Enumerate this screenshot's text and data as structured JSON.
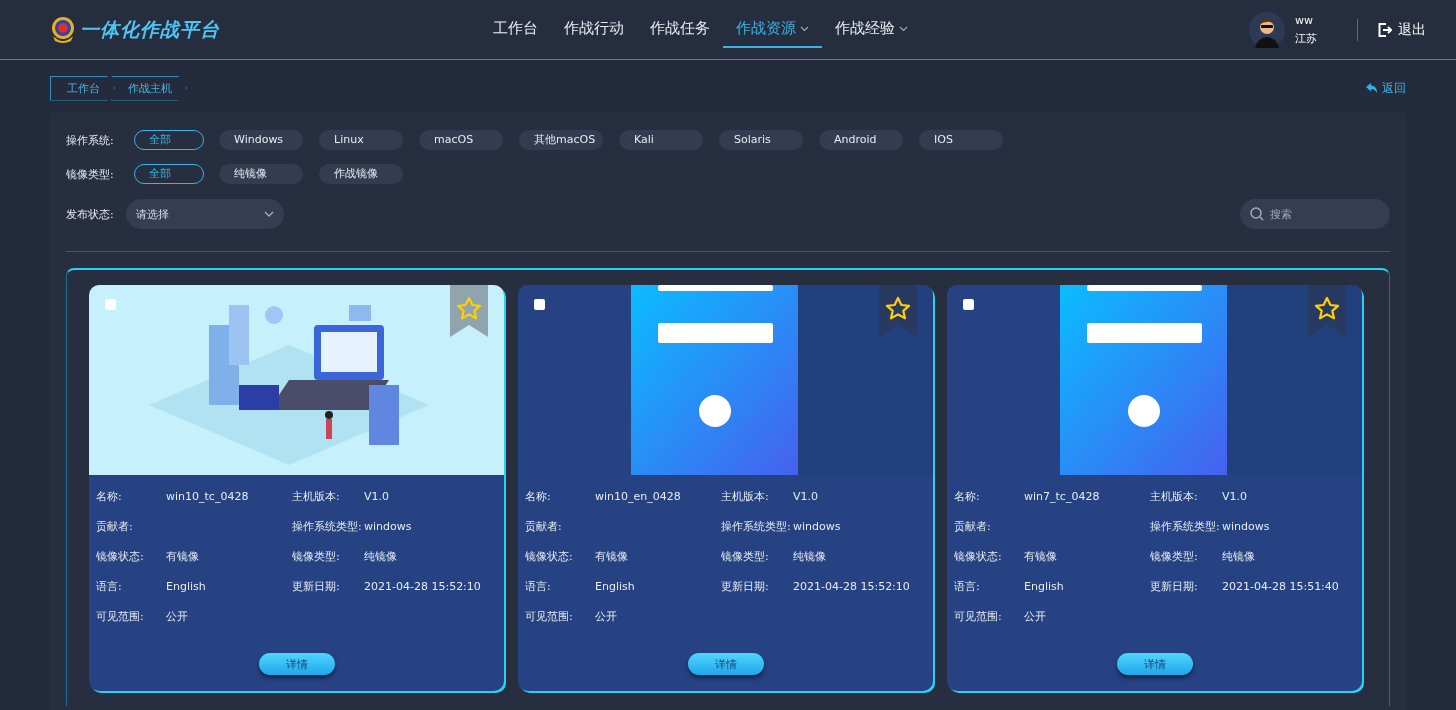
{
  "header": {
    "title": "一体化作战平台",
    "nav": [
      {
        "label": "工作台",
        "selected": false,
        "dropdown": false
      },
      {
        "label": "作战行动",
        "selected": false,
        "dropdown": false
      },
      {
        "label": "作战任务",
        "selected": false,
        "dropdown": false
      },
      {
        "label": "作战资源",
        "selected": true,
        "dropdown": true
      },
      {
        "label": "作战经验",
        "selected": false,
        "dropdown": true
      }
    ],
    "user": {
      "name": "ww",
      "region": "江苏"
    },
    "logout": "退出"
  },
  "breadcrumb": [
    {
      "label": "工作台"
    },
    {
      "label": "作战主机"
    }
  ],
  "back": "返回",
  "filters": [
    {
      "label": "操作系统:",
      "options": [
        {
          "label": "全部",
          "selected": true
        },
        {
          "label": "Windows",
          "selected": false
        },
        {
          "label": "Linux",
          "selected": false
        },
        {
          "label": "macOS",
          "selected": false
        },
        {
          "label": "其他macOS",
          "selected": false
        },
        {
          "label": "Kali",
          "selected": false
        },
        {
          "label": "Solaris",
          "selected": false
        },
        {
          "label": "Android",
          "selected": false
        },
        {
          "label": "IOS",
          "selected": false
        }
      ]
    },
    {
      "label": "镜像类型:",
      "options": [
        {
          "label": "全部",
          "selected": true
        },
        {
          "label": "纯镜像",
          "selected": false
        },
        {
          "label": "作战镜像",
          "selected": false
        }
      ]
    }
  ],
  "status_filter": {
    "label": "发布状态:",
    "placeholder": "请选择"
  },
  "search": {
    "placeholder": "搜索"
  },
  "cards": [
    {
      "checked": false,
      "image": {
        "kind": "illustration"
      },
      "button": "详情",
      "fields": [
        {
          "label": "名称:",
          "value": "win10_tc_0428"
        },
        {
          "label": "主机版本:",
          "value": "V1.0"
        },
        {
          "label": "贡献者:"
        },
        {
          "label": "操作系统类型:",
          "value": "windows"
        },
        {
          "label": "镜像状态:",
          "value": "有镜像"
        },
        {
          "label": "镜像类型:",
          "value": "纯镜像"
        },
        {
          "label": "语言:",
          "value": "English"
        },
        {
          "label": "更新日期:",
          "value": "2021-04-28 15:52:10"
        },
        {
          "label": "可见范围:",
          "value": "公开"
        }
      ]
    },
    {
      "checked": false,
      "image": {
        "kind": "server"
      },
      "button": "详情",
      "fields": [
        {
          "label": "名称:",
          "value": "win10_en_0428"
        },
        {
          "label": "主机版本:",
          "value": "V1.0"
        },
        {
          "label": "贡献者:"
        },
        {
          "label": "操作系统类型:",
          "value": "windows"
        },
        {
          "label": "镜像状态:",
          "value": "有镜像"
        },
        {
          "label": "镜像类型:",
          "value": "纯镜像"
        },
        {
          "label": "语言:",
          "value": "English"
        },
        {
          "label": "更新日期:",
          "value": "2021-04-28 15:52:10"
        },
        {
          "label": "可见范围:",
          "value": "公开"
        }
      ]
    },
    {
      "checked": false,
      "image": {
        "kind": "server"
      },
      "button": "详情",
      "fields": [
        {
          "label": "名称:",
          "value": "win7_tc_0428"
        },
        {
          "label": "主机版本:",
          "value": "V1.0"
        },
        {
          "label": "贡献者:"
        },
        {
          "label": "操作系统类型:",
          "value": "windows"
        },
        {
          "label": "镜像状态:",
          "value": "有镜像"
        },
        {
          "label": "镜像类型:",
          "value": "纯镜像"
        },
        {
          "label": "语言:",
          "value": "English"
        },
        {
          "label": "更新日期:",
          "value": "2021-04-28 15:51:40"
        },
        {
          "label": "可见范围:",
          "value": "公开"
        }
      ]
    }
  ]
}
